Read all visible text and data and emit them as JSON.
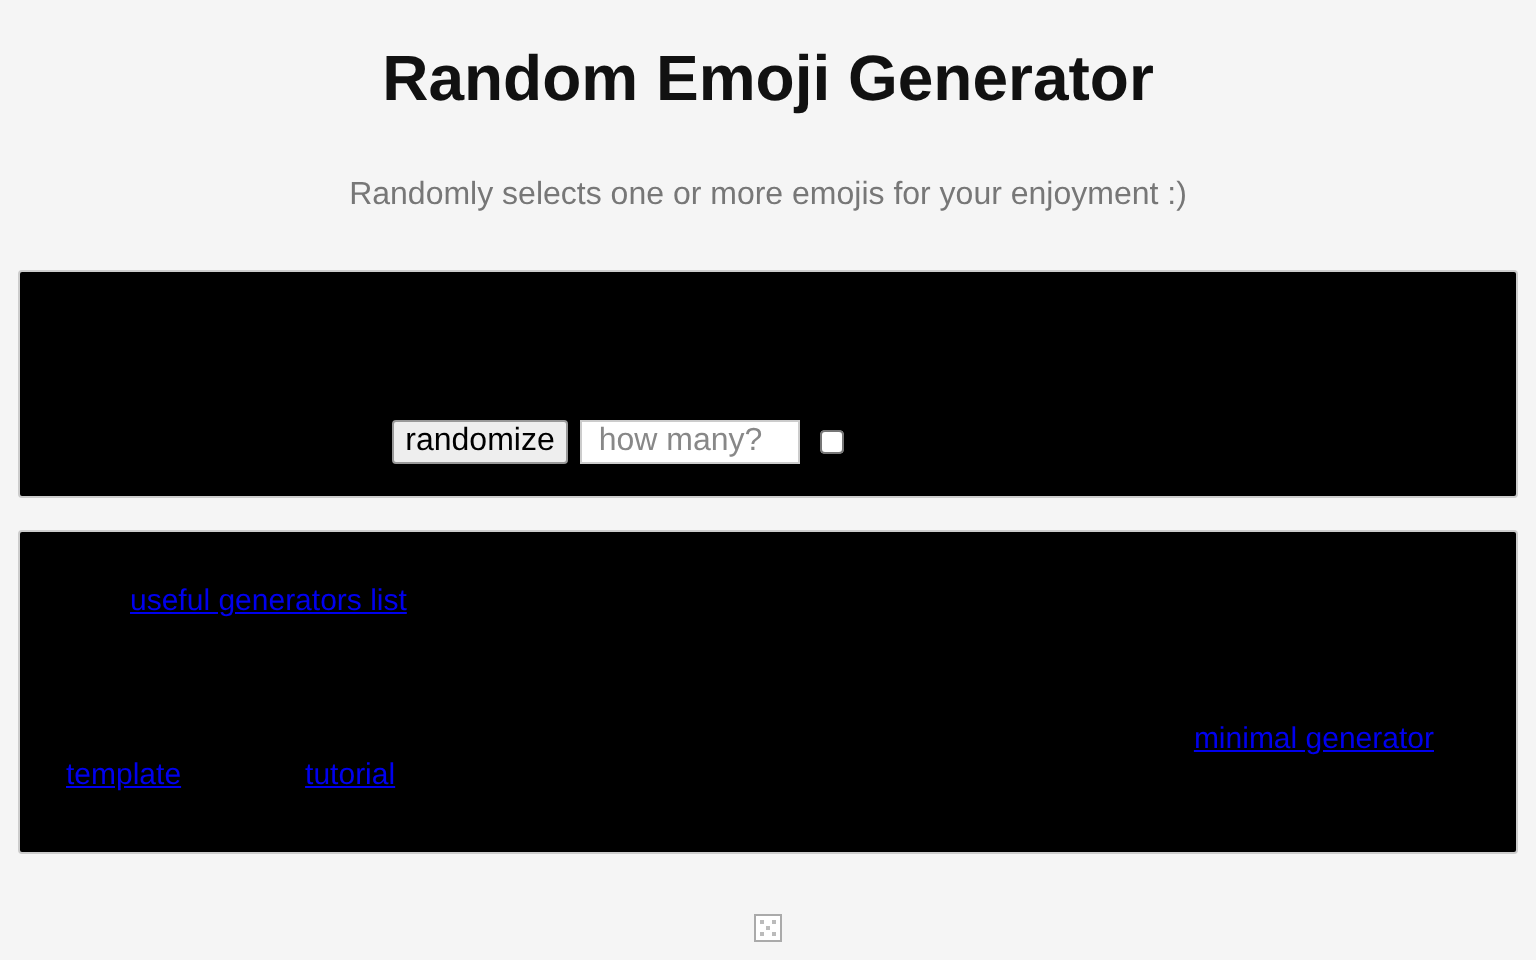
{
  "title": "Random Emoji Generator",
  "subtitle": "Randomly selects one or more emojis for your enjoyment :)",
  "controls": {
    "button": "randomize",
    "count_field": {
      "placeholder": "how many?"
    },
    "checkbox": {
      "checked": false
    }
  },
  "links": [
    {
      "label": "useful generators list"
    },
    {
      "label": "minimal generator"
    },
    {
      "label": "template"
    },
    {
      "label": "tutorial"
    }
  ]
}
